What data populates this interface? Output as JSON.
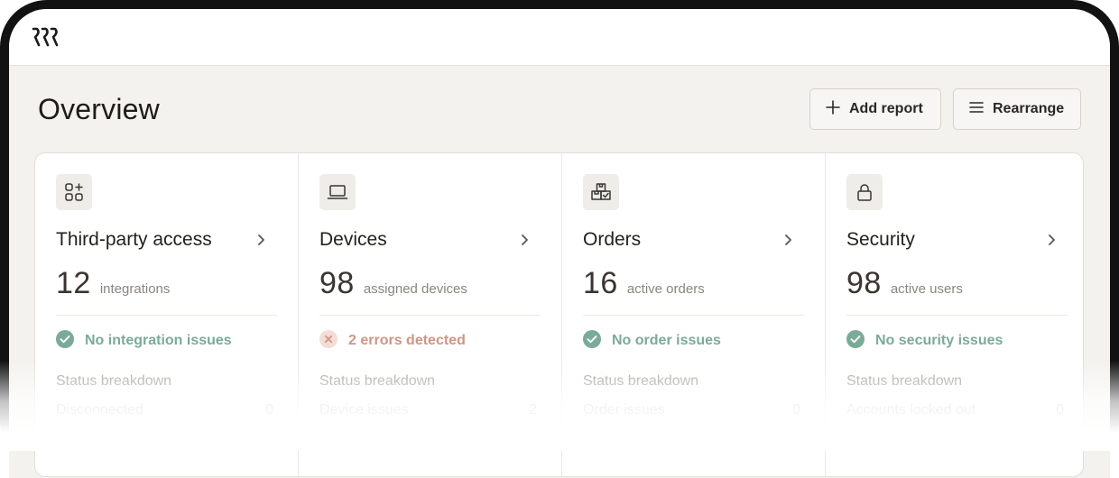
{
  "app": {
    "logo": "logo-mark"
  },
  "header": {
    "title": "Overview"
  },
  "toolbar": {
    "add_label": "Add report",
    "rearrange_label": "Rearrange"
  },
  "colors": {
    "ok": "#7aab98",
    "error": "#d09585",
    "background": "#f4f2ef"
  },
  "cards": [
    {
      "icon": "apps-add-icon",
      "title": "Third-party access",
      "metric": "12",
      "unit": "integrations",
      "status": "ok",
      "status_text": "No integration issues",
      "breakdown_label": "Status breakdown",
      "row_label": "Disconnected",
      "row_value": "0"
    },
    {
      "icon": "laptop-icon",
      "title": "Devices",
      "metric": "98",
      "unit": "assigned devices",
      "status": "error",
      "status_text": "2 errors detected",
      "breakdown_label": "Status breakdown",
      "row_label": "Device issues",
      "row_value": "2"
    },
    {
      "icon": "boxes-icon",
      "title": "Orders",
      "metric": "16",
      "unit": "active orders",
      "status": "ok",
      "status_text": "No order issues",
      "breakdown_label": "Status breakdown",
      "row_label": "Order issues",
      "row_value": "0"
    },
    {
      "icon": "lock-icon",
      "title": "Security",
      "metric": "98",
      "unit": "active users",
      "status": "ok",
      "status_text": "No security issues",
      "breakdown_label": "Status breakdown",
      "row_label": "Accounts locked out",
      "row_value": "0"
    }
  ]
}
